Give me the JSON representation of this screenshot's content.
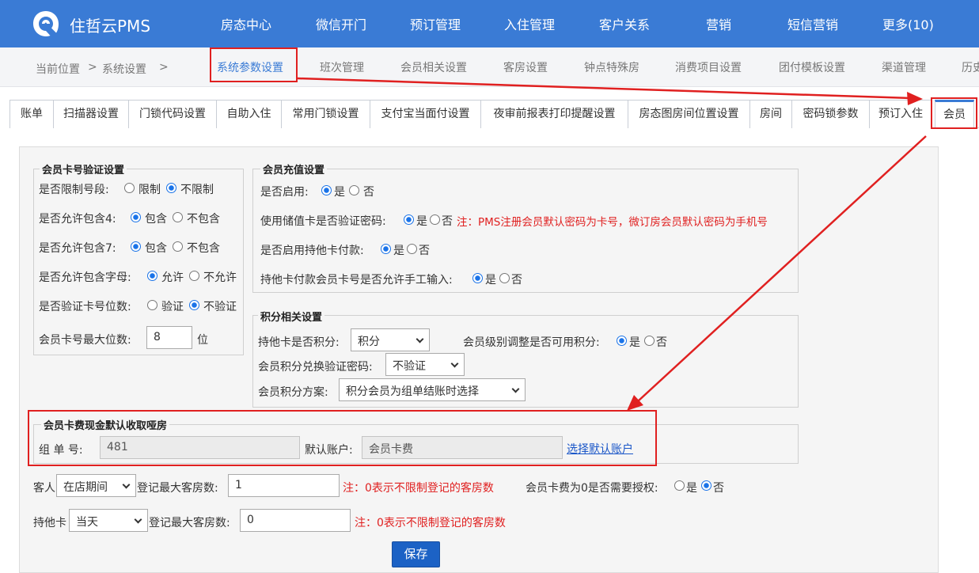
{
  "brand": {
    "name": "住哲云PMS"
  },
  "top_nav": [
    "房态中心",
    "微信开门",
    "预订管理",
    "入住管理",
    "客户关系",
    "营销",
    "短信营销",
    "更多(10)"
  ],
  "breadcrumb": {
    "label": "当前位置",
    "sep1": ">",
    "item": "系统设置",
    "sep2": ">"
  },
  "sub_tabs": [
    "系统参数设置",
    "班次管理",
    "会员相关设置",
    "客房设置",
    "钟点特殊房",
    "消费项目设置",
    "团付模板设置",
    "渠道管理",
    "历史"
  ],
  "inner_tabs": [
    "账单",
    "扫描器设置",
    "门锁代码设置",
    "自助入住",
    "常用门锁设置",
    "支付宝当面付设置",
    "夜审前报表打印提醒设置",
    "房态图房间位置设置",
    "房间",
    "密码锁参数",
    "预订入住",
    "会员"
  ],
  "card_verify": {
    "title": "会员卡号验证设置",
    "limit_label": "是否限制号段:",
    "limit_yes": "限制",
    "limit_no": "不限制",
    "four_label": "是否允许包含4:",
    "four_yes": "包含",
    "four_no": "不包含",
    "seven_label": "是否允许包含7:",
    "seven_yes": "包含",
    "seven_no": "不包含",
    "letter_label": "是否允许包含字母:",
    "letter_yes": "允许",
    "letter_no": "不允许",
    "digits_label": "是否验证卡号位数:",
    "digits_yes": "验证",
    "digits_no": "不验证",
    "max_label": "会员卡号最大位数:",
    "max_value": "8",
    "max_unit": "位"
  },
  "recharge": {
    "title": "会员充值设置",
    "enable_label": "是否启用:",
    "enable_yes": "是",
    "enable_no": "否",
    "pwd_label": "使用储值卡是否验证密码:",
    "pwd_yes": "是",
    "pwd_no": "否",
    "pwd_note": "注：PMS注册会员默认密码为卡号，微订房会员默认密码为手机号",
    "other_label": "是否启用持他卡付款:",
    "other_yes": "是",
    "other_no": "否",
    "manual_label": "持他卡付款会员卡号是否允许手工输入:",
    "manual_yes": "是",
    "manual_no": "否"
  },
  "points": {
    "title": "积分相关设置",
    "other_label": "持他卡是否积分:",
    "other_value": "积分",
    "level_label": "会员级别调整是否可用积分:",
    "level_yes": "是",
    "level_no": "否",
    "verify_label": "会员积分兑换验证密码:",
    "verify_value": "不验证",
    "plan_label": "会员积分方案:",
    "plan_value": "积分会员为组单结账时选择"
  },
  "cash_fee": {
    "title": "会员卡费现金默认收取哑房",
    "group_label": "组 单 号:",
    "group_value": "481",
    "account_label": "默认账户:",
    "account_value": "会员卡费",
    "choose_link": "选择默认账户"
  },
  "limits": {
    "guest_label": "客人",
    "guest_select": "在店期间",
    "guest_max_label": "登记最大客房数:",
    "guest_max_value": "1",
    "guest_note": "注：0表示不限制登记的客房数",
    "auth_label": "会员卡费为0是否需要授权:",
    "auth_yes": "是",
    "auth_no": "否",
    "other_label": "持他卡",
    "other_select": "当天",
    "other_max_label": "登记最大客房数:",
    "other_max_value": "0",
    "other_note": "注：0表示不限制登记的客房数"
  },
  "save_label": "保存",
  "colors": {
    "nav": "#3a7bd5",
    "annotation": "#e02020",
    "save": "#1c62c5"
  }
}
